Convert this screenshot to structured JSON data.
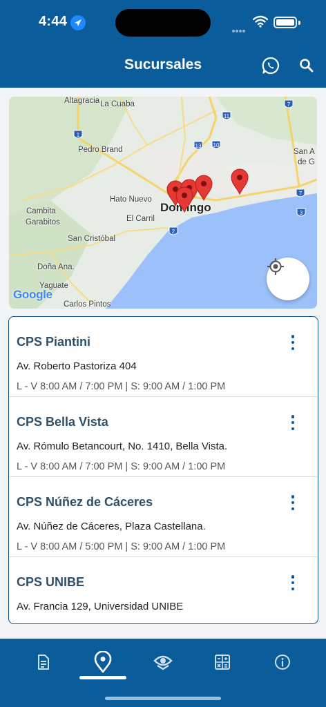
{
  "status_bar": {
    "time": "4:44"
  },
  "header": {
    "title": "Sucursales",
    "whatsapp_icon": "whatsapp-icon",
    "search_icon": "search-icon"
  },
  "map": {
    "labels": {
      "altagracia": "Altagracia",
      "la_cuaba": "La Cuaba",
      "pedro_brand": "Pedro Brand",
      "san_a": "San A",
      "de_g": "de G",
      "hato_nuevo": "Hato Nuevo",
      "domingo": "Domingo",
      "el_carril": "El Carril",
      "cambita": "Cambita",
      "garabitos": "Garabitos",
      "san_cristobal": "San Cristóbal",
      "dona_ana": "Doña Ana.",
      "yaguate": "Yaguate",
      "carlos_pinto": "Carlos Pintos"
    },
    "route_shields": [
      "1",
      "7",
      "11",
      "13",
      "10",
      "7",
      "3",
      "2"
    ],
    "attribution": "Google",
    "locate_icon": "crosshair-icon",
    "accent_color": "#e53935"
  },
  "branches": [
    {
      "name": "CPS Piantini",
      "address": "Av. Roberto Pastoriza 404",
      "hours": "L - V 8:00 AM / 7:00 PM | S: 9:00 AM / 1:00 PM"
    },
    {
      "name": "CPS Bella Vista",
      "address": "Av. Rómulo Betancourt, No. 1410, Bella Vista.",
      "hours": "L - V 8:00 AM / 7:00 PM | S: 9:00 AM / 1:00 PM"
    },
    {
      "name": "CPS Núñez de Cáceres",
      "address": "Av. Núñez de Cáceres, Plaza Castellana.",
      "hours": "L - V 8:00 AM / 5:00 PM | S: 9:00 AM / 1:00 PM"
    },
    {
      "name": "CPS UNIBE",
      "address": "Av. Francia 129, Universidad UNIBE",
      "hours": ""
    }
  ],
  "tabbar": {
    "tabs": [
      "document-icon",
      "location-pin-icon",
      "eye-shield-icon",
      "calculator-icon",
      "info-icon"
    ],
    "active": "location-pin-icon"
  },
  "colors": {
    "primary": "#0b5c9b",
    "title_text": "#2f4f69",
    "water": "#9cc0f9"
  }
}
